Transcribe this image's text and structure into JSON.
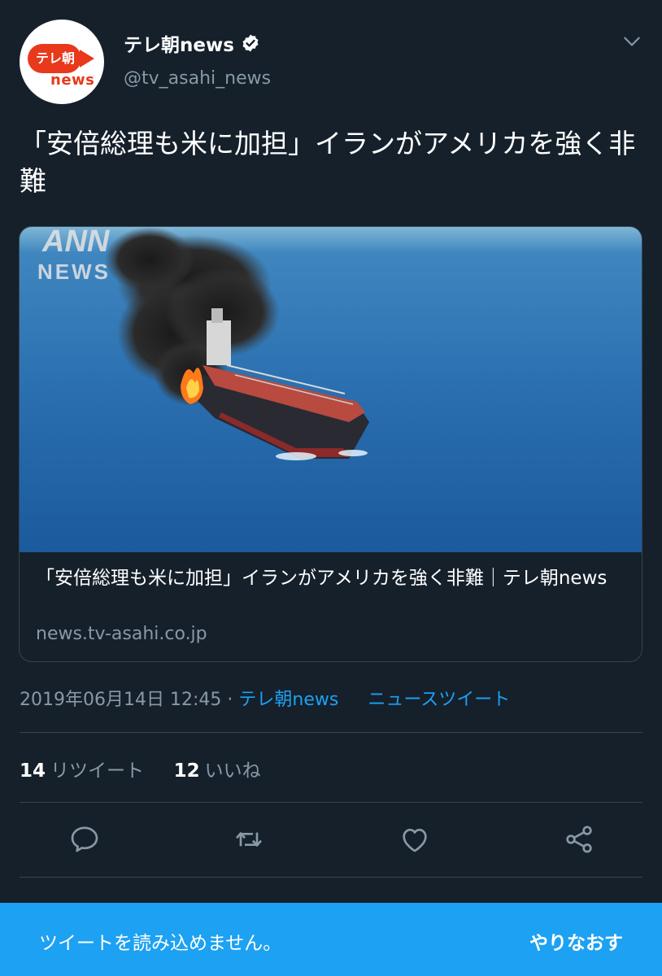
{
  "account": {
    "display_name": "テレ朝news",
    "handle": "@tv_asahi_news",
    "avatar_text_top": "テレ朝",
    "avatar_text_bottom": "news"
  },
  "tweet": {
    "text": "「安倍総理も米に加担」イランがアメリカを強く非難"
  },
  "card": {
    "image_watermark_top": "ANN",
    "image_watermark_bottom": "NEWS",
    "title": "「安倍総理も米に加担」イランがアメリカを強く非難｜テレ朝news",
    "domain": "news.tv-asahi.co.jp"
  },
  "meta": {
    "timestamp": "2019年06月14日 12:45",
    "separator": "·",
    "source": "テレ朝news",
    "category": "ニュースツイート"
  },
  "stats": {
    "retweet_count": "14",
    "retweet_label": "リツイート",
    "like_count": "12",
    "like_label": "いいね"
  },
  "actions": {
    "icons": [
      "reply-icon",
      "retweet-icon",
      "like-icon",
      "share-icon"
    ]
  },
  "banner": {
    "message": "ツイートを読み込めません。",
    "retry_label": "やりなおす"
  },
  "colors": {
    "background": "#15202b",
    "accent": "#1da1f2",
    "secondary_text": "#8899a6",
    "brand_red": "#e8391c"
  }
}
